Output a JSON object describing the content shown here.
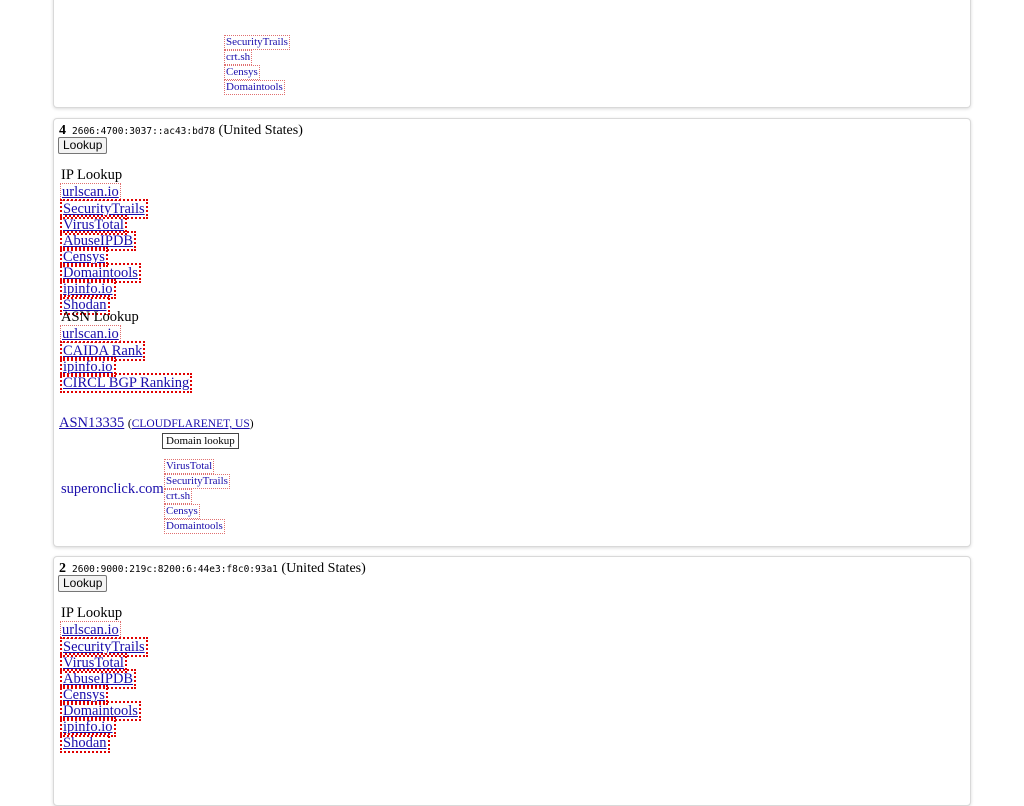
{
  "top_card": {
    "links": [
      "SecurityTrails",
      "crt.sh",
      "Censys",
      "Domaintools"
    ]
  },
  "cards": [
    {
      "rank": "4",
      "ip": "2606:4700:3037::ac43:bd78",
      "country": "(United States)",
      "lookup_label": "Lookup",
      "ip_lookup_heading": "IP Lookup",
      "ip_links": [
        "urlscan.io",
        "SecurityTrails",
        "VirusTotal",
        "AbuseIPDB",
        "Censys",
        "Domaintools",
        "ipinfo.io",
        "Shodan"
      ],
      "asn_lookup_heading": "ASN Lookup",
      "asn_links": [
        "urlscan.io",
        "CAIDA Rank",
        "ipinfo.io",
        "CIRCL BGP Ranking"
      ],
      "asn": "ASN13335",
      "asn_org": "CLOUDFLARENET, US",
      "domain_lookup_label": "Domain lookup",
      "domain": "superonclick.com",
      "domain_links": [
        "VirusTotal",
        "SecurityTrails",
        "crt.sh",
        "Censys",
        "Domaintools"
      ]
    },
    {
      "rank": "2",
      "ip": "2600:9000:219c:8200:6:44e3:f8c0:93a1",
      "country": "(United States)",
      "lookup_label": "Lookup",
      "ip_lookup_heading": "IP Lookup",
      "ip_links": [
        "urlscan.io",
        "SecurityTrails",
        "VirusTotal",
        "AbuseIPDB",
        "Censys",
        "Domaintools",
        "ipinfo.io",
        "Shodan"
      ]
    }
  ]
}
